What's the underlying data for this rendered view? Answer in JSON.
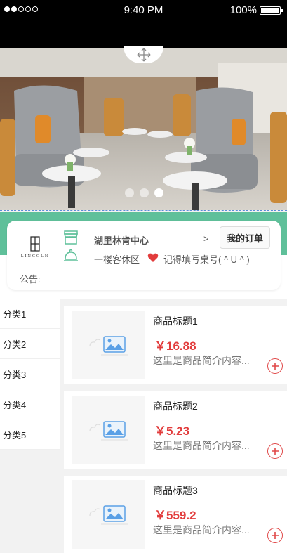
{
  "status_bar": {
    "time": "9:40 PM",
    "battery": "100%"
  },
  "banner": {
    "image_description_icon": "hotel-lounge-photo",
    "dots_count": 3,
    "active_dot": 3
  },
  "store": {
    "logo_text": "LINCOLN",
    "name": "湖里林肯中心",
    "arrow": ">",
    "orders_button": "我的订单",
    "area": "一楼客休区",
    "tip": "记得填写桌号( ^ U ^ )",
    "notice_label": "公告:"
  },
  "colors": {
    "accent_green": "#5fc09a",
    "price_red": "#e23c3c"
  },
  "categories": [
    {
      "label": "分类1"
    },
    {
      "label": "分类2"
    },
    {
      "label": "分类3"
    },
    {
      "label": "分类4"
    },
    {
      "label": "分类5"
    }
  ],
  "products": [
    {
      "title": "商品标题1",
      "price": "￥16.88",
      "desc": "这里是商品简介内容..."
    },
    {
      "title": "商品标题2",
      "price": "￥5.23",
      "desc": "这里是商品简介内容..."
    },
    {
      "title": "商品标题3",
      "price": "￥559.2",
      "desc": "这里是商品简介内容..."
    }
  ]
}
